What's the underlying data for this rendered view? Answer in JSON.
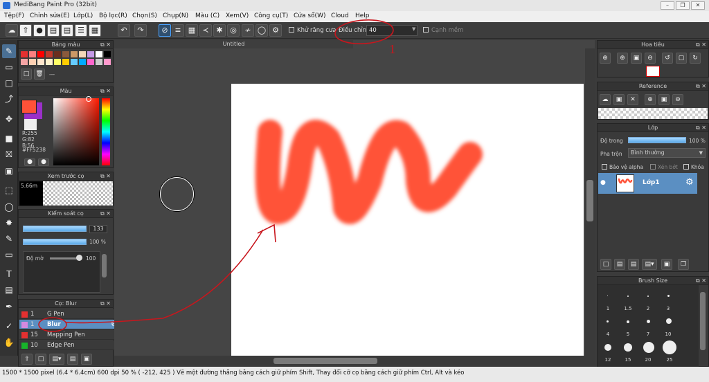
{
  "window": {
    "title": "MediBang Paint Pro (32bit)"
  },
  "menu": [
    "Tệp(F)",
    "Chỉnh sửa(E)",
    "Lớp(L)",
    "Bộ lọc(R)",
    "Chọn(S)",
    "Chụp(N)",
    "Màu (C)",
    "Xem(V)",
    "Công cụ(T)",
    "Cửa sổ(W)",
    "Cloud",
    "Help"
  ],
  "toolbar": {
    "antialias_label": "Khử răng cưa",
    "adjust_label": "Điều chỉnh",
    "adjust_value": "40",
    "smooth_edge_label": "Cạnh mềm"
  },
  "panels": {
    "palette": {
      "title": "Bảng màu",
      "empty_label": "---"
    },
    "color": {
      "title": "Màu",
      "r": "R:255",
      "g": "G:82",
      "b": "B:56",
      "hex": "#FF5238"
    },
    "preview": {
      "title": "Xem trước cọ",
      "size": "5.66m"
    },
    "brush_control": {
      "title": "Kiểm soát cọ",
      "size_value": "133",
      "opacity_value": "100 %",
      "blur_label": "Độ mờ",
      "blur_value": "100"
    },
    "brush_list": {
      "title": "Cọ: Blur",
      "items": [
        {
          "num": "1",
          "name": "G Pen",
          "color": "#e53030",
          "selected": false
        },
        {
          "num": "1",
          "name": "Blur",
          "color": "#d58ae0",
          "selected": true
        },
        {
          "num": "15",
          "name": "Mapping Pen",
          "color": "#e53030",
          "selected": false
        },
        {
          "num": "10",
          "name": "Edge Pen",
          "color": "#17b52a",
          "selected": false
        }
      ]
    },
    "navigator": {
      "title": "Hoa tiêu"
    },
    "reference": {
      "title": "Reference"
    },
    "layer": {
      "title": "Lớp",
      "opacity_label": "Độ trong",
      "opacity_value": "100 %",
      "blend_label": "Pha trộn",
      "blend_value": "Bình thường",
      "protect_alpha": "Bảo vệ alpha",
      "clipping": "Xén bớt",
      "lock": "Khóa",
      "layer_name": "Lớp1"
    },
    "brush_size": {
      "title": "Brush Size",
      "sizes": [
        "1",
        "1.5",
        "2",
        "3",
        "4",
        "5",
        "7",
        "10",
        "12",
        "15",
        "20",
        "25"
      ]
    }
  },
  "document": {
    "title": "Untitled"
  },
  "annotation": {
    "number": "1"
  },
  "status": "1500 * 1500 pixel  (6.4 * 6.4cm)  600 dpi  50 %  ( -212, 425 )  Vẽ một đường thẳng bằng cách giữ phím Shift, Thay đổi cỡ cọ bằng cách giữ phím Ctrl, Alt và kéo",
  "colors": {
    "accent": "#5b8fc2",
    "paint": "#FF5238",
    "annotation": "#c8161d"
  }
}
